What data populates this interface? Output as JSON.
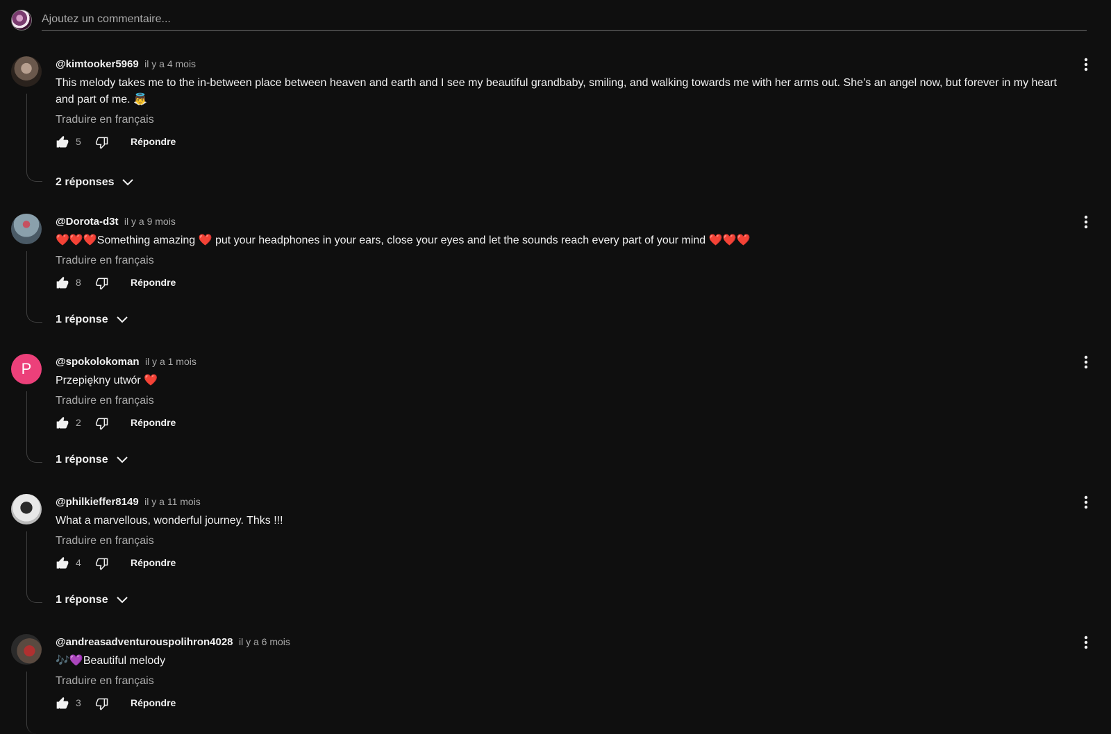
{
  "add_comment": {
    "placeholder": "Ajoutez un commentaire..."
  },
  "comments": [
    {
      "author": "@kimtooker5969",
      "time": "il y a 4 mois",
      "text": "This melody takes me to the in-between place between heaven and earth and I see my beautiful grandbaby, smiling, and walking towards me with her arms out. She’s an angel now, but forever in my heart and part of me. 👼",
      "translate": "Traduire en français",
      "likes": "5",
      "reply_label": "Répondre",
      "replies_label": "2 réponses",
      "avatar_colors": [
        "#8a7a70",
        "#3a302a"
      ]
    },
    {
      "author": "@Dorota-d3t",
      "time": "il y a 9 mois",
      "text": "❤️❤️❤️Something amazing ❤️ put your headphones in your ears, close your eyes and let the sounds reach every part of your mind ❤️❤️❤️",
      "translate": "Traduire en français",
      "likes": "8",
      "reply_label": "Répondre",
      "replies_label": "1 réponse",
      "avatar_colors": [
        "#9aa8b0",
        "#4a5a66"
      ]
    },
    {
      "author": "@spokolokoman",
      "time": "il y a 1 mois",
      "text": "Przepiękny utwór ❤️",
      "translate": "Traduire en français",
      "likes": "2",
      "reply_label": "Répondre",
      "replies_label": "1 réponse",
      "avatar_letter": "P",
      "avatar_colors": [
        "#ec407a",
        "#ec407a"
      ]
    },
    {
      "author": "@philkieffer8149",
      "time": "il y a 11 mois",
      "text": "What a marvellous, wonderful journey. Thks !!!",
      "translate": "Traduire en français",
      "likes": "4",
      "reply_label": "Répondre",
      "replies_label": "1 réponse",
      "avatar_colors": [
        "#e8e8e8",
        "#222222"
      ]
    },
    {
      "author": "@andreasadventurouspolihron4028",
      "time": "il y a 6 mois",
      "text": "🎶💜Beautiful melody",
      "translate": "Traduire en français",
      "likes": "3",
      "reply_label": "Répondre",
      "avatar_colors": [
        "#b03030",
        "#2a2a2a"
      ]
    }
  ],
  "colors": {
    "background": "#0f0f0f",
    "text": "#f1f1f1",
    "secondary": "#aaaaaa",
    "heart": "#e8173b",
    "avatar_letter_bg": "#ec407a"
  }
}
